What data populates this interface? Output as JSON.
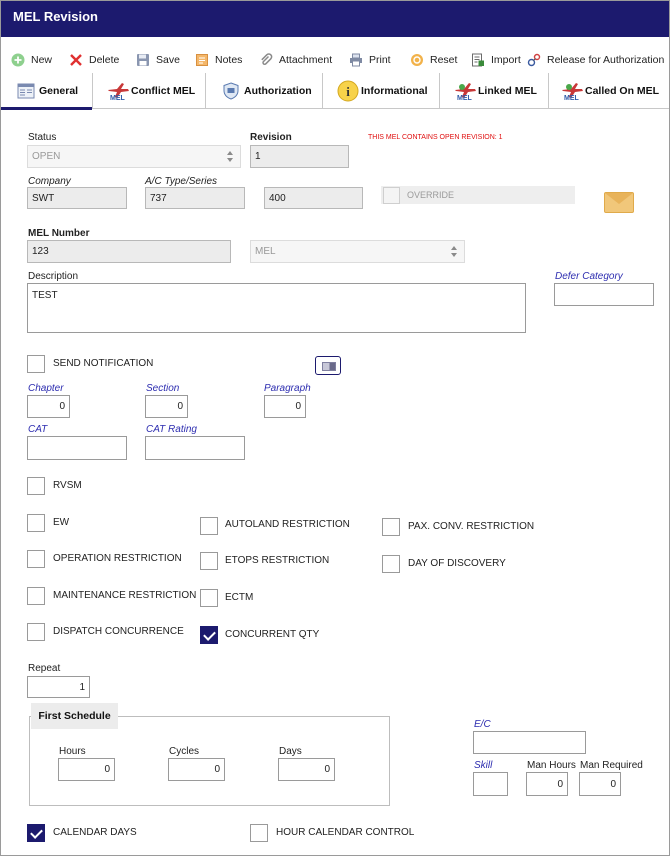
{
  "window": {
    "title": "MEL Revision"
  },
  "toolbar": {
    "new": "New",
    "delete": "Delete",
    "save": "Save",
    "notes": "Notes",
    "attachment": "Attachment",
    "print": "Print",
    "reset": "Reset",
    "import": "Import",
    "release": "Release for Authorization"
  },
  "tabs": [
    {
      "label": "General"
    },
    {
      "label": "Conflict MEL"
    },
    {
      "label": "Authorization"
    },
    {
      "label": "Informational"
    },
    {
      "label": "Linked MEL"
    },
    {
      "label": "Called On MEL"
    }
  ],
  "form": {
    "status": {
      "label": "Status",
      "value": "OPEN"
    },
    "revision": {
      "label": "Revision",
      "value": "1"
    },
    "open_revision_notice": "THIS MEL CONTAINS OPEN REVISION: 1",
    "company": {
      "label": "Company",
      "value": "SWT"
    },
    "ac_type": {
      "label": "A/C Type/Series",
      "type": "737",
      "series": "400"
    },
    "override": {
      "label": "OVERRIDE",
      "checked": false
    },
    "mel_number": {
      "label": "MEL Number",
      "value": "123"
    },
    "mel_type": {
      "value": "MEL"
    },
    "description": {
      "label": "Description",
      "value": "TEST"
    },
    "defer_category": {
      "label": "Defer Category",
      "value": ""
    },
    "send_notification": {
      "label": "SEND NOTIFICATION",
      "checked": false
    },
    "chapter": {
      "label": "Chapter",
      "value": "0"
    },
    "section": {
      "label": "Section",
      "value": "0"
    },
    "paragraph": {
      "label": "Paragraph",
      "value": "0"
    },
    "cat": {
      "label": "CAT",
      "value": ""
    },
    "cat_rating": {
      "label": "CAT Rating",
      "value": ""
    },
    "checkboxes": {
      "rvsm": {
        "label": "RVSM",
        "checked": false
      },
      "ew": {
        "label": "EW",
        "checked": false
      },
      "autoland": {
        "label": "AUTOLAND RESTRICTION",
        "checked": false
      },
      "pax_conv": {
        "label": "PAX. CONV. RESTRICTION",
        "checked": false
      },
      "operation": {
        "label": "OPERATION RESTRICTION",
        "checked": false
      },
      "etops": {
        "label": "ETOPS RESTRICTION",
        "checked": false
      },
      "day_of_discovery": {
        "label": "DAY OF DISCOVERY",
        "checked": false
      },
      "maintenance": {
        "label": "MAINTENANCE RESTRICTION",
        "checked": false
      },
      "ectm": {
        "label": "ECTM",
        "checked": false
      },
      "dispatch": {
        "label": "DISPATCH CONCURRENCE",
        "checked": false
      },
      "concurrent_qty": {
        "label": "CONCURRENT QTY",
        "checked": true
      }
    },
    "repeat": {
      "label": "Repeat",
      "value": "1"
    },
    "first_schedule": {
      "title": "First Schedule",
      "hours": {
        "label": "Hours",
        "value": "0"
      },
      "cycles": {
        "label": "Cycles",
        "value": "0"
      },
      "days": {
        "label": "Days",
        "value": "0"
      }
    },
    "ec": {
      "label": "E/C",
      "value": ""
    },
    "skill": {
      "label": "Skill",
      "value": ""
    },
    "man_hours": {
      "label": "Man Hours",
      "value": "0"
    },
    "man_required": {
      "label": "Man Required",
      "value": "0"
    },
    "calendar_days": {
      "label": "CALENDAR DAYS",
      "checked": true
    },
    "hour_calendar_control": {
      "label": "HOUR CALENDAR CONTROL",
      "checked": false
    }
  },
  "colors": {
    "title_bar": "#1c1a6e",
    "accent": "#1c1a6e",
    "italic_label": "#2d2db0",
    "notice": "#e01010"
  },
  "icons": [
    "plus-circle-icon",
    "delete-x-icon",
    "save-disk-icon",
    "notes-icon",
    "paperclip-icon",
    "printer-icon",
    "reset-icon",
    "import-icon",
    "release-icon",
    "general-tab-icon",
    "conflict-plane-icon",
    "shield-icon",
    "info-icon",
    "linked-plane-icon",
    "called-plane-icon",
    "envelope-icon",
    "image-button-icon"
  ]
}
